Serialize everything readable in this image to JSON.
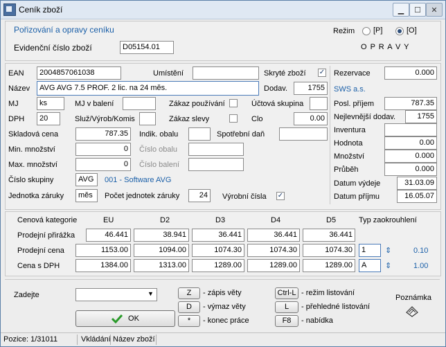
{
  "window": {
    "title": "Ceník zboží"
  },
  "header": {
    "section_title": "Pořizování a opravy ceníku",
    "evid_label": "Evidenční číslo zboží",
    "evid_value": "D05154.01",
    "mode_label": "Režim",
    "mode_p": "[P]",
    "mode_o": "[O]",
    "mode_selected": "O",
    "mode_status": "O P R A V Y"
  },
  "form": {
    "ean_label": "EAN",
    "ean_value": "2004857061038",
    "umisteni_label": "Umístění",
    "umisteni_value": "",
    "skryte_label": "Skryté zboží",
    "skryte_checked": "✓",
    "nazev_label": "Název",
    "nazev_value": "AVG AVG 7.5  PROF. 2 lic. na 24 měs.",
    "dodav_label": "Dodav.",
    "dodav_value": "1755",
    "mj_label": "MJ",
    "mj_value": "ks",
    "mj_baleni_label": "MJ v balení",
    "mj_baleni_value": "",
    "zakaz_pouzivani_label": "Zákaz používání",
    "ucetni_label": "Účtová skupina",
    "ucetni_value": "",
    "dph_label": "DPH",
    "dph_value": "20",
    "sluz_label": "Služ/Výrob/Komis",
    "sluz_value": "",
    "zakaz_slevy_label": "Zákaz slevy",
    "clo_label": "Clo",
    "clo_value": "0.00",
    "skladova_label": "Skladová cena",
    "skladova_value": "787.35",
    "indik_label": "Indik. obalu",
    "indik_value": "",
    "spotrebni_label": "Spotřební daň",
    "spotrebni_value": "",
    "min_label": "Min. množství",
    "min_value": "0",
    "cislo_obalu_label": "Číslo obalu",
    "cislo_obalu_value": "",
    "max_label": "Max. množství",
    "max_value": "0",
    "cislo_baleni_label": "Číslo balení",
    "cislo_baleni_value": "",
    "cislo_skupiny_label": "Číslo skupiny",
    "cislo_skupiny_value": "AVG",
    "cislo_skupiny_text": "001 - Software AVG",
    "jednotka_label": "Jednotka záruky",
    "jednotka_value": "měs",
    "pocet_label": "Počet jednotek záruky",
    "pocet_value": "24",
    "vyrobni_label": "Výrobní čísla",
    "vyrobni_checked": "✓"
  },
  "right": {
    "rezervace_label": "Rezervace",
    "rezervace_value": "0.000",
    "supplier_name": "SWS a.s.",
    "posl_prijem_label": "Posl. příjem",
    "posl_prijem_value": "787.35",
    "nejlevnejsi_label": "Nejlevnější dodav.",
    "nejlevnejsi_value": "1755",
    "inventura_label": "Inventura",
    "inventura_value": "",
    "hodnota_label": "Hodnota",
    "hodnota_value": "0.00",
    "mnozstvi_label": "Množství",
    "mnozstvi_value": "0.000",
    "prubeh_label": "Průběh",
    "prubeh_value": "0.000",
    "datum_vydeje_label": "Datum výdeje",
    "datum_vydeje_value": "31.03.09",
    "datum_prijmu_label": "Datum příjmu",
    "datum_prijmu_value": "16.05.07"
  },
  "pricing": {
    "col_header": "Cenová kategorie",
    "categories": [
      "EU",
      "D2",
      "D3",
      "D4",
      "D5"
    ],
    "typ_label": "Typ zaokrouhlení",
    "rows": [
      {
        "label": "Prodejní přirážka",
        "values": [
          "46.441",
          "38.941",
          "36.441",
          "36.441",
          "36.441"
        ]
      },
      {
        "label": "Prodejní cena",
        "values": [
          "1153.00",
          "1094.00",
          "1074.30",
          "1074.30",
          "1074.30"
        ],
        "typ": "1",
        "typ_value": "0.10"
      },
      {
        "label": "Cena s DPH",
        "values": [
          "1384.00",
          "1313.00",
          "1289.00",
          "1289.00",
          "1289.00"
        ],
        "typ": "A",
        "typ_value": "1.00"
      }
    ]
  },
  "bottom": {
    "zadejte_label": "Zadejte",
    "zadejte_value": "",
    "ok_label": "OK",
    "keys": [
      {
        "key": "Z",
        "desc": "- zápis věty"
      },
      {
        "key": "D",
        "desc": "- výmaz věty"
      },
      {
        "key": "*",
        "desc": "- konec práce"
      },
      {
        "key": "Ctrl-L",
        "desc": "- režim listování"
      },
      {
        "key": "L",
        "desc": "- přehledné listování"
      },
      {
        "key": "F8",
        "desc": "- nabídka"
      }
    ],
    "poznamka_label": "Poznámka"
  },
  "status": {
    "pozice": "Pozice: 1/31011",
    "vkladani": "Vkládání",
    "nazev": "Název zboží"
  }
}
